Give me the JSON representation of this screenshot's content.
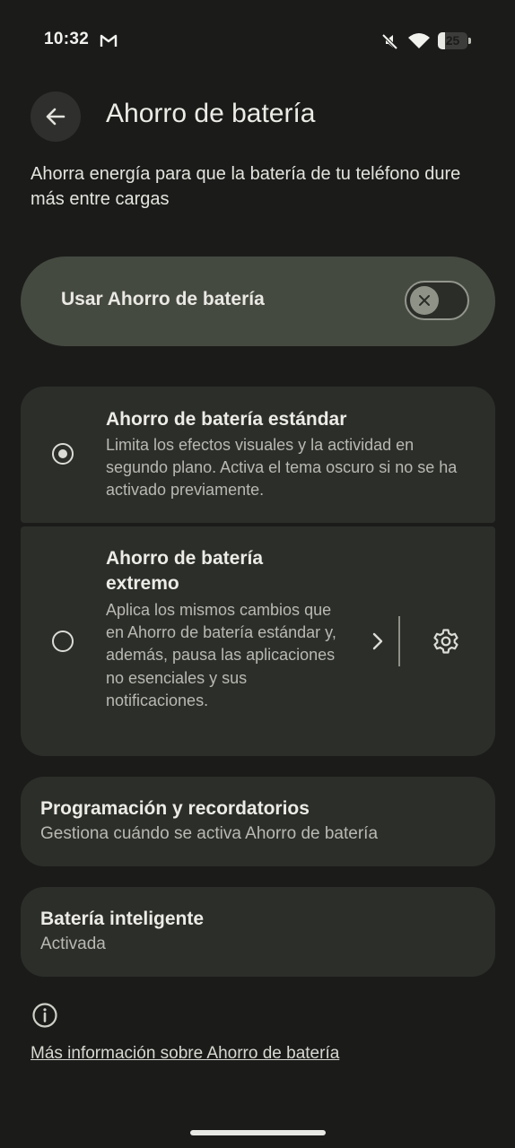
{
  "status_bar": {
    "time": "10:32",
    "battery_level": "25",
    "icons": [
      "gmail-icon",
      "mute-icon",
      "wifi-icon",
      "battery-icon"
    ]
  },
  "header": {
    "title": "Ahorro de batería",
    "back_icon": "back-arrow-icon"
  },
  "description": "Ahorra energía para que la batería de tu teléfono dure más entre cargas",
  "main_toggle": {
    "label": "Usar Ahorro de batería",
    "state": "off"
  },
  "options": {
    "standard": {
      "title": "Ahorro de batería estándar",
      "description": "Limita los efectos visuales y la actividad en segundo plano. Activa el tema oscuro si no se ha activado previamente.",
      "selected": true
    },
    "extreme": {
      "title": "Ahorro de batería extremo",
      "description": "Aplica los mismos cambios que en Ahorro de batería estándar y, además, pausa las aplicaciones no esenciales y sus notificaciones.",
      "selected": false
    }
  },
  "schedule": {
    "title": "Programación y recordatorios",
    "subtitle": "Gestiona cuándo se activa Ahorro de batería"
  },
  "smart_battery": {
    "title": "Batería inteligente",
    "subtitle": "Activada"
  },
  "footer": {
    "learn_more": "Más información sobre Ahorro de batería"
  },
  "colors": {
    "background": "#1b1c1a",
    "card": "#2c2e2a",
    "toggle_card": "#454a41",
    "text_primary": "#ecebe6",
    "text_secondary": "#b9b9b2"
  }
}
